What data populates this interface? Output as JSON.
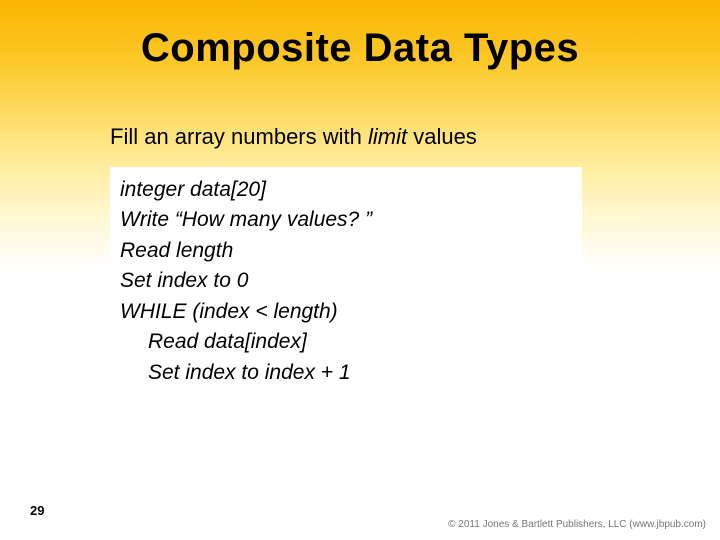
{
  "title": "Composite Data Types",
  "subtitle_prefix": "Fill an array numbers with ",
  "subtitle_italic": "limit",
  "subtitle_suffix": " values",
  "code": {
    "l1": "integer data[20]",
    "l2": "Write “How many values? ”",
    "l3": "Read length",
    "l4": "Set index to 0",
    "l5": "WHILE (index < length)",
    "l6": "Read data[index]",
    "l7": "Set index to index + 1"
  },
  "page_number": "29",
  "footer": "© 2011 Jones & Bartlett Publishers, LLC (www.jbpub.com)"
}
